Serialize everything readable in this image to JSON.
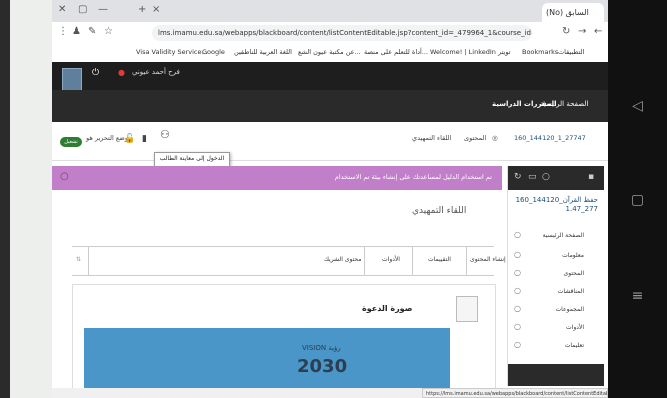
{
  "browser": {
    "tab_title": "(No) السابق",
    "url": "lms.imamu.edu.sa/webapps/blackboard/content/listContentEditable.jsp?content_id=_479964_1&course_id=_72153_1&content_id=_479964_1",
    "bookmarks": [
      "Visa Validity Service...",
      "Google",
      "اللغة العربية للناطقين",
      "عن مكتبة عيون الشع...",
      "أداة للتعلم على منصة...",
      "Welcome! | LinkedIn",
      "تويتر",
      "Bookmarks",
      "التطبيقات"
    ],
    "status_url": "https://lms.imamu.edu.sa/webapps/blackboard/content/listContentEditable..."
  },
  "bb": {
    "user_name": "فرح أحمد عيوني",
    "nav_links": [
      "الصفحة الرئيسية",
      "المقررات الدراسية"
    ],
    "course_id": "160_144120_1_27747",
    "breadcrumb": [
      "المحتوى",
      "اللقاء التمهيدي"
    ],
    "edit_mode_label": "وضع التحرير هو",
    "toggle_label": "تشغيل",
    "tooltip": "الدخول إلى معاينة الطالب\nتشغيل عرض الطالب",
    "banner_text": "تم استخدام الدليل لمساعدتك على إنشاء بيئة تم الاستخدام",
    "page_title": "اللقاء التمهيدي",
    "filters": [
      "إنشاء المحتوى",
      "التقييمات",
      "الأدوات",
      "محتوى الشريك"
    ],
    "item_title": "صورة الدعوة",
    "poster_text_small": "VISION رؤية",
    "poster_text": "2030"
  },
  "sidebar": {
    "course_title": "160_144120_حفظ القرآن 277_1.47",
    "items": [
      "الصفحة الرئيسية",
      "معلومات",
      "المحتوى",
      "المناقشات",
      "المجموعات",
      "الأدوات",
      "تعليمات"
    ]
  }
}
